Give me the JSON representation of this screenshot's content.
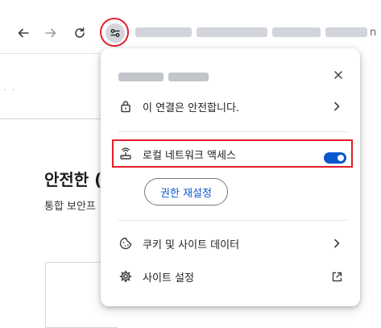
{
  "toolbar": {
    "back_icon": "arrow-left-icon",
    "forward_icon": "arrow-right-icon",
    "reload_icon": "reload-icon",
    "site_info_icon": "tune-icon",
    "url_visible_tail": "n"
  },
  "background_page": {
    "heading": "안전한 (",
    "subtext": "통합 보안프"
  },
  "popup": {
    "close_icon": "close-icon",
    "connection_label": "이 연결은 안전합니다.",
    "connection_icon": "lock-icon",
    "local_network_label": "로컬 네트워크 액세스",
    "local_network_icon": "local-network-icon",
    "local_network_enabled": true,
    "reset_permissions_label": "권한 재설정",
    "cookies_label": "쿠키 및 사이트 데이터",
    "cookies_icon": "cookie-icon",
    "site_settings_label": "사이트 설정",
    "site_settings_icon": "settings-gear-icon",
    "external_link_icon": "open-in-new-icon"
  },
  "colors": {
    "accent_blue": "#0b57d0",
    "highlight_red": "#e21d2a"
  }
}
